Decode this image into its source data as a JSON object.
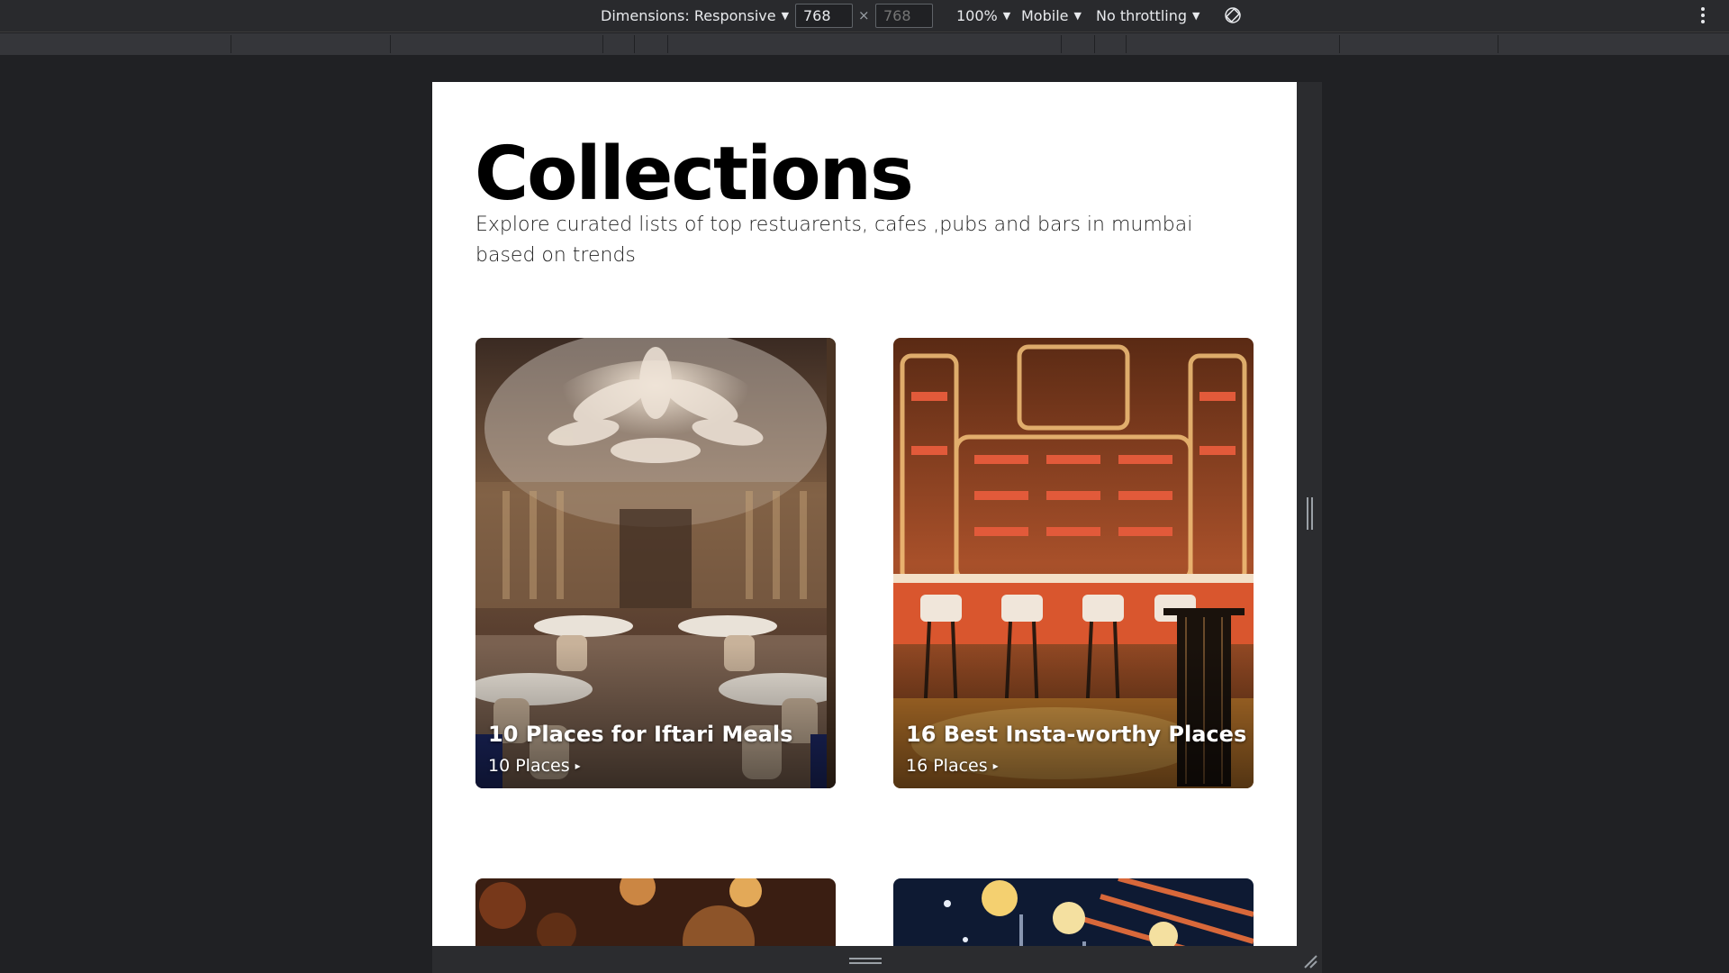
{
  "devtools": {
    "dimensions_label": "Dimensions: Responsive",
    "width_value": "768",
    "height_placeholder": "768",
    "times": "×",
    "zoom": "100%",
    "throttle_profile": "Mobile",
    "network": "No throttling"
  },
  "page": {
    "title": "Collections",
    "subtitle": "Explore curated lists of top restuarents, cafes ,pubs and bars in mumbai based on trends"
  },
  "cards": [
    {
      "title": "10 Places for Iftari Meals",
      "count": "10 Places",
      "arrow": "▸"
    },
    {
      "title": "16 Best Insta-worthy Places",
      "count": "16 Places",
      "arrow": "▸"
    }
  ]
}
